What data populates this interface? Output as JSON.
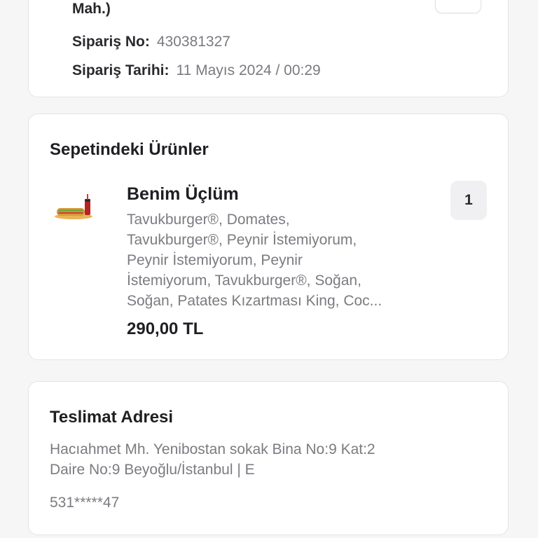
{
  "order": {
    "mah_fragment": "Mah.)",
    "order_no_label": "Sipariş No:",
    "order_no_value": "430381327",
    "order_date_label": "Sipariş Tarihi:",
    "order_date_value": "11 Mayıs 2024 / 00:29",
    "toggle_icon": "chevron-icon"
  },
  "basket": {
    "title": "Sepetindeki Ürünler",
    "items": [
      {
        "name": "Benim Üçlüm",
        "description_lines": [
          "Tavukburger®, Domates,",
          "Tavukburger®, Peynir İstemiyorum,",
          "Peynir İstemiyorum, Peynir",
          "İstemiyorum, Tavukburger®, Soğan,",
          "Soğan, Patates Kızartması King, Coc..."
        ],
        "price": "290,00 TL",
        "quantity": "1",
        "image_icon": "burger-meal-icon"
      }
    ]
  },
  "address": {
    "title": "Teslimat Adresi",
    "lines": [
      "Hacıahmet Mh. Yenibostan sokak Bina No:9 Kat:2",
      "Daire No:9 Beyoğlu/İstanbul | E"
    ],
    "phone": "531*****47"
  },
  "colors": {
    "background": "#f6f6f7",
    "card": "#ffffff",
    "border": "#e4e4e8",
    "primary_text": "#1f1f23",
    "secondary_text": "#7b7b81",
    "badge_bg": "#f0f0f3"
  }
}
